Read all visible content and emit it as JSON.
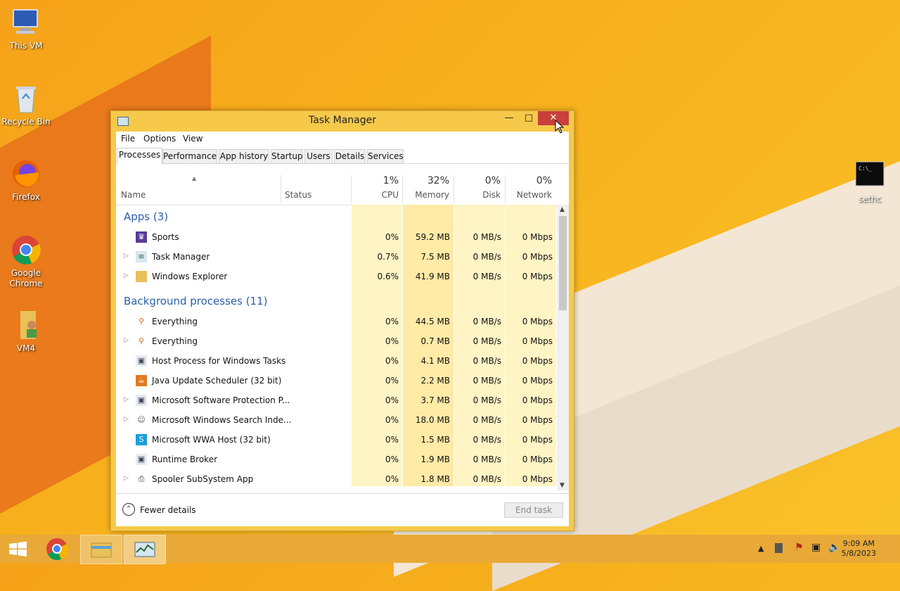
{
  "desktop_icons": [
    {
      "label": "This VM",
      "icon": "computer-icon"
    },
    {
      "label": "Recycle Bin",
      "icon": "recycle-bin-icon"
    },
    {
      "label": "Firefox",
      "icon": "firefox-icon"
    },
    {
      "label": "Google Chrome",
      "icon": "chrome-icon"
    },
    {
      "label": "VM4",
      "icon": "folder-user-icon"
    },
    {
      "label": "sethc",
      "icon": "console-icon"
    }
  ],
  "window": {
    "title": "Task Manager",
    "menu": [
      "File",
      "Options",
      "View"
    ],
    "tabs": [
      "Processes",
      "Performance",
      "App history",
      "Startup",
      "Users",
      "Details",
      "Services"
    ],
    "active_tab": "Processes",
    "columns": {
      "name": "Name",
      "status": "Status",
      "cpu": {
        "label": "CPU",
        "pct": "1%"
      },
      "memory": {
        "label": "Memory",
        "pct": "32%"
      },
      "disk": {
        "label": "Disk",
        "pct": "0%"
      },
      "network": {
        "label": "Network",
        "pct": "0%"
      }
    },
    "groups": [
      {
        "title": "Apps (3)",
        "rows": [
          {
            "name": "Sports",
            "expandable": false,
            "icon": "trophy-icon",
            "cpu": "0%",
            "memory": "59.2 MB",
            "disk": "0 MB/s",
            "network": "0 Mbps"
          },
          {
            "name": "Task Manager",
            "expandable": true,
            "icon": "task-manager-icon",
            "cpu": "0.7%",
            "memory": "7.5 MB",
            "disk": "0 MB/s",
            "network": "0 Mbps"
          },
          {
            "name": "Windows Explorer",
            "expandable": true,
            "icon": "folder-icon",
            "cpu": "0.6%",
            "memory": "41.9 MB",
            "disk": "0 MB/s",
            "network": "0 Mbps"
          }
        ]
      },
      {
        "title": "Background processes (11)",
        "rows": [
          {
            "name": "Everything",
            "expandable": false,
            "icon": "magnifier-icon",
            "cpu": "0%",
            "memory": "44.5 MB",
            "disk": "0 MB/s",
            "network": "0 Mbps"
          },
          {
            "name": "Everything",
            "expandable": true,
            "icon": "magnifier-icon",
            "cpu": "0%",
            "memory": "0.7 MB",
            "disk": "0 MB/s",
            "network": "0 Mbps"
          },
          {
            "name": "Host Process for Windows Tasks",
            "expandable": false,
            "icon": "window-process-icon",
            "cpu": "0%",
            "memory": "4.1 MB",
            "disk": "0 MB/s",
            "network": "0 Mbps"
          },
          {
            "name": "Java Update Scheduler (32 bit)",
            "expandable": false,
            "icon": "java-icon",
            "cpu": "0%",
            "memory": "2.2 MB",
            "disk": "0 MB/s",
            "network": "0 Mbps"
          },
          {
            "name": "Microsoft Software Protection P...",
            "expandable": true,
            "icon": "window-process-icon",
            "cpu": "0%",
            "memory": "3.7 MB",
            "disk": "0 MB/s",
            "network": "0 Mbps"
          },
          {
            "name": "Microsoft Windows Search Inde...",
            "expandable": true,
            "icon": "search-person-icon",
            "cpu": "0%",
            "memory": "18.0 MB",
            "disk": "0 MB/s",
            "network": "0 Mbps"
          },
          {
            "name": "Microsoft WWA Host (32 bit)",
            "expandable": false,
            "icon": "skype-icon",
            "cpu": "0%",
            "memory": "1.5 MB",
            "disk": "0 MB/s",
            "network": "0 Mbps"
          },
          {
            "name": "Runtime Broker",
            "expandable": false,
            "icon": "window-process-icon",
            "cpu": "0%",
            "memory": "1.9 MB",
            "disk": "0 MB/s",
            "network": "0 Mbps"
          },
          {
            "name": "Spooler SubSystem App",
            "expandable": true,
            "icon": "printer-icon",
            "cpu": "0%",
            "memory": "1.8 MB",
            "disk": "0 MB/s",
            "network": "0 Mbps"
          }
        ]
      }
    ],
    "fewer_details": "Fewer details",
    "end_task": "End task"
  },
  "taskbar": {
    "pinned": [
      "start-icon",
      "chrome-icon",
      "file-explorer-icon",
      "task-manager-icon"
    ],
    "time": "9:09 AM",
    "date": "5/8/2023"
  },
  "colors": {
    "accent": "#2a5fa6",
    "heat_light": "#fff4c4",
    "heat_mid": "#ffeaa6",
    "close_red": "#c7403a",
    "frame": "#f6c94a"
  }
}
